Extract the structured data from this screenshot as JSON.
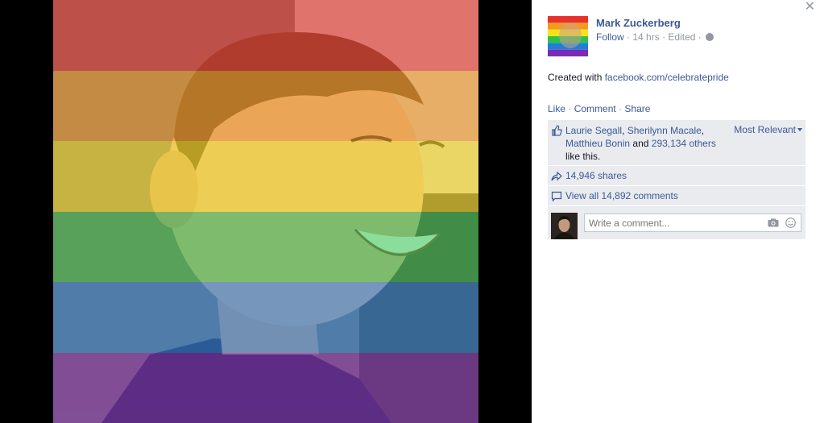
{
  "photo": {
    "stripe_colors": [
      "#e8312b",
      "#f39a20",
      "#f7e21b",
      "#2ec24a",
      "#1f7fd6",
      "#7a2bb5"
    ]
  },
  "post": {
    "author": "Mark Zuckerberg",
    "follow": "Follow",
    "time": "14 hrs",
    "edited": "Edited",
    "sep": "·",
    "caption_prefix": "Created with",
    "caption_link": "facebook.com/celebratepride"
  },
  "actions": {
    "like": "Like",
    "comment": "Comment",
    "share": "Share",
    "sep": "·"
  },
  "ufi": {
    "liker1": "Laurie Segall",
    "liker2": "Sherilynn Macale",
    "liker3": "Matthieu Bonin",
    "and_text": "and",
    "others": "293,134 others",
    "like_this": "like this.",
    "comma": ",",
    "sort": "Most Relevant",
    "shares": "14,946 shares",
    "view_comments": "View all 14,892 comments",
    "comment_placeholder": "Write a comment..."
  },
  "icons": {
    "close": "close-icon",
    "globe": "globe-icon",
    "like": "thumbs-up-icon",
    "share": "share-arrow-icon",
    "comment": "comment-bubble-icon",
    "camera": "camera-icon",
    "emoji": "smiley-icon"
  },
  "colors": {
    "link": "#3b5998",
    "meta": "#9197a3",
    "ufi_bg": "#e9ebee"
  }
}
